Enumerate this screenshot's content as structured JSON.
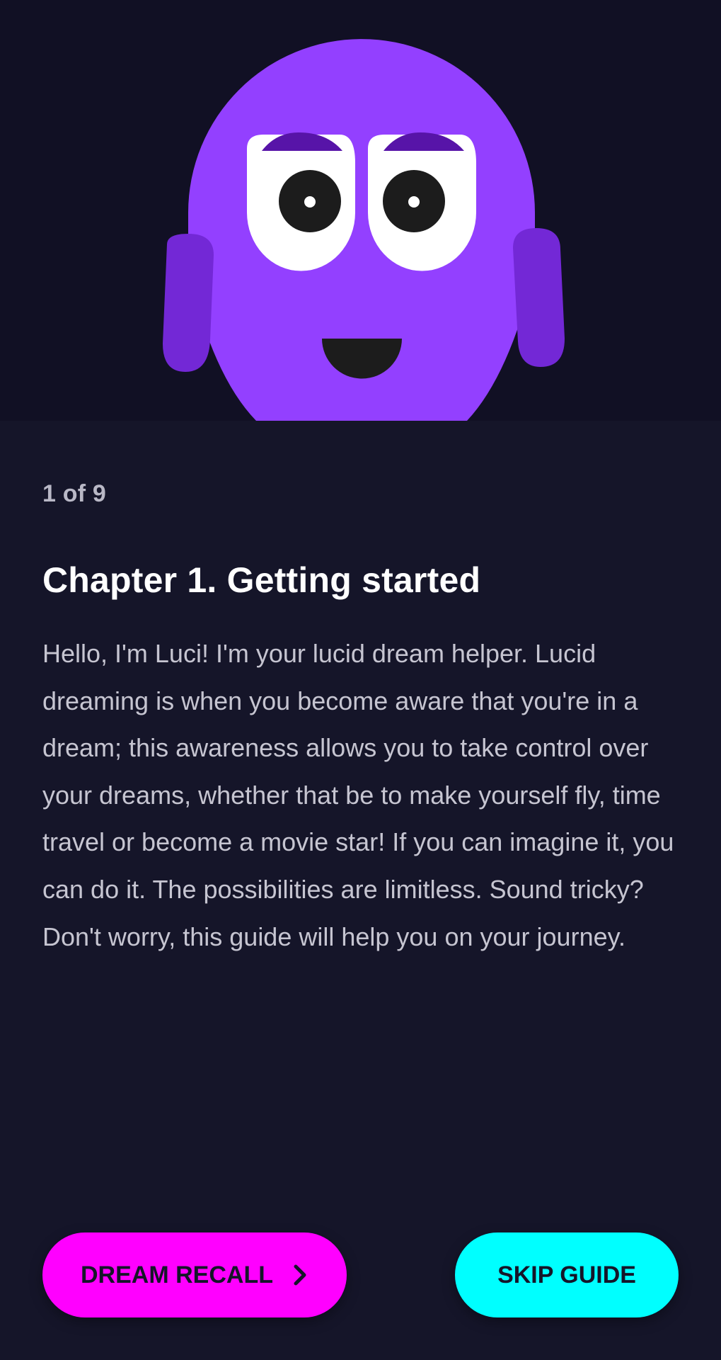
{
  "hero": {
    "illustration": "luci-mascot",
    "colors": {
      "background": "#111024",
      "body": "#9340ff",
      "arms": "#7328d6",
      "eyelid": "#5714a8",
      "eye_white": "#ffffff",
      "pupil": "#1c1c1c",
      "mouth": "#1c1c1c"
    }
  },
  "guide": {
    "step_indicator": "1 of 9",
    "title": "Chapter 1. Getting started",
    "body": "Hello, I'm Luci! I'm your lucid dream helper. Lucid dreaming is when you become aware that you're in a dream; this awareness allows you to take control over your dreams, whether that be to make yourself fly, time travel or become a movie star! If you can imagine it, you can do it. The possibilities are limitless. Sound tricky? Don't worry, this guide will help you on your journey."
  },
  "actions": {
    "next_label": "DREAM RECALL",
    "next_icon": "chevron-right-icon",
    "skip_label": "SKIP GUIDE"
  },
  "theme": {
    "page_background": "#151529",
    "primary_button": "#ff00ff",
    "secondary_button": "#00ffff"
  }
}
